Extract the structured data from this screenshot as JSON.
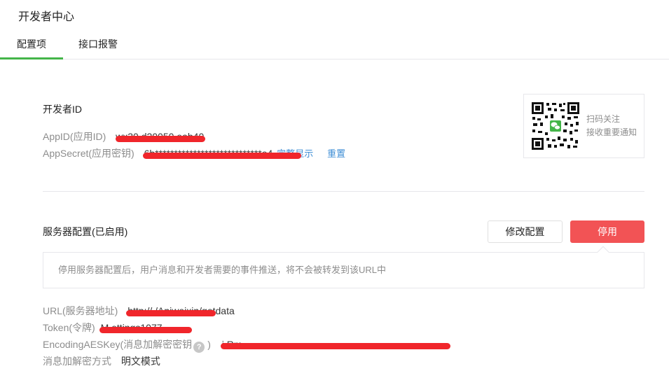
{
  "page_title": "开发者中心",
  "tabs": [
    {
      "label": "配置项",
      "active": true
    },
    {
      "label": "接口报警",
      "active": false
    }
  ],
  "developer_id": {
    "section_title": "开发者ID",
    "appid_label": "AppID(应用ID)",
    "appid_value": "wx30      d20050      eab40",
    "appsecret_label": "AppSecret(应用密钥)",
    "appsecret_value": "6b****************************e4",
    "show_full_link": "完整显示",
    "reset_link": "重置"
  },
  "qr": {
    "line1": "扫码关注",
    "line2": "接收重要通知",
    "accent_color": "#44b549"
  },
  "server_config": {
    "section_title": "服务器配置(已启用)",
    "modify_button": "修改配置",
    "disable_button": "停用",
    "notice": "停用服务器配置后，用户消息和开发者需要的事件推送，将不会被转发到该URL中",
    "url_label": "URL(服务器地址)",
    "url_value": "http://          /Apiweixin/getdata",
    "token_label": "Token(令牌)",
    "token_value": "M        ettings1077",
    "aes_label": "EncodingAESKey(消息加解密密钥",
    "aes_help_icon": "?",
    "aes_label_end": ")",
    "aes_value": "i                                   Rm",
    "mode_label": "消息加解密方式",
    "mode_value": "明文模式"
  },
  "colors": {
    "accent_green": "#44b549",
    "danger_red": "#f25355",
    "link_blue": "#3e8ed5",
    "redaction_red": "#f0262b"
  }
}
